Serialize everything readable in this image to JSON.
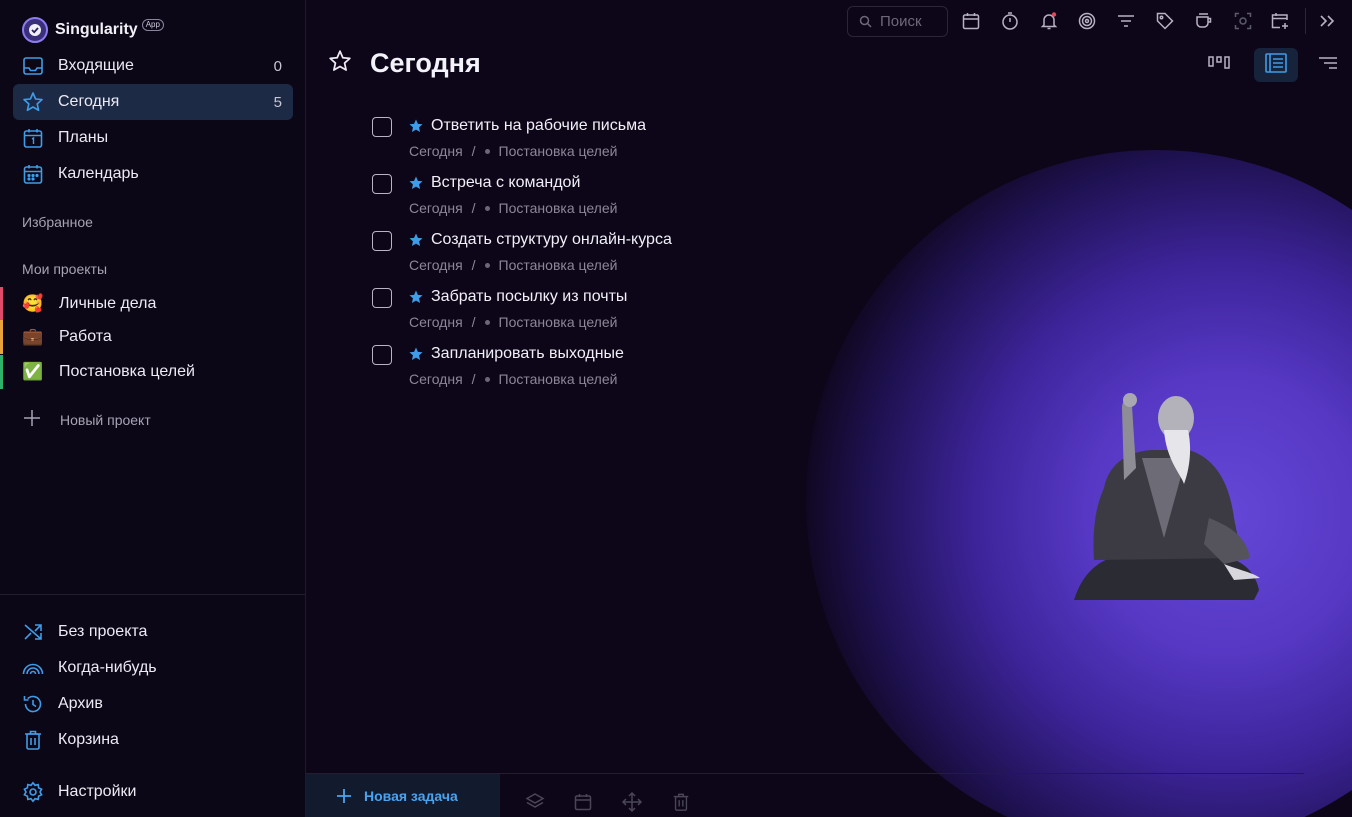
{
  "app": {
    "name": "Singularity",
    "badge": "App"
  },
  "nav": {
    "inbox": {
      "label": "Входящие",
      "count": "0"
    },
    "today": {
      "label": "Сегодня",
      "count": "5"
    },
    "plans": {
      "label": "Планы"
    },
    "calendar": {
      "label": "Календарь"
    }
  },
  "sections": {
    "favorites": "Избранное",
    "my_projects": "Мои проекты"
  },
  "projects": [
    {
      "label": "Личные дела",
      "emoji": "🥰",
      "color": "#e04a6a"
    },
    {
      "label": "Работа",
      "emoji": "💼",
      "color": "#e8a33a"
    },
    {
      "label": "Постановка целей",
      "emoji": "✅",
      "color": "#2fb36b"
    }
  ],
  "new_project_label": "Новый проект",
  "bottom_nav": {
    "no_project": "Без проекта",
    "someday": "Когда-нибудь",
    "archive": "Архив",
    "trash": "Корзина",
    "settings": "Настройки"
  },
  "search": {
    "placeholder": "Поиск"
  },
  "page": {
    "title": "Сегодня"
  },
  "tasks": [
    {
      "title": "Ответить на рабочие письма",
      "when": "Сегодня",
      "sep": "/",
      "project": "Постановка целей"
    },
    {
      "title": "Встреча с командой",
      "when": "Сегодня",
      "sep": "/",
      "project": "Постановка целей"
    },
    {
      "title": "Создать структуру онлайн-курса",
      "when": "Сегодня",
      "sep": "/",
      "project": "Постановка целей"
    },
    {
      "title": "Забрать посылку из почты",
      "when": "Сегодня",
      "sep": "/",
      "project": "Постановка целей"
    },
    {
      "title": "Запланировать выходные",
      "when": "Сегодня",
      "sep": "/",
      "project": "Постановка целей"
    }
  ],
  "new_task_label": "Новая задача",
  "colors": {
    "accent": "#3f9ce8",
    "background": "#0d0618",
    "glow": "#5a3dd0",
    "notification": "#e0485a"
  }
}
